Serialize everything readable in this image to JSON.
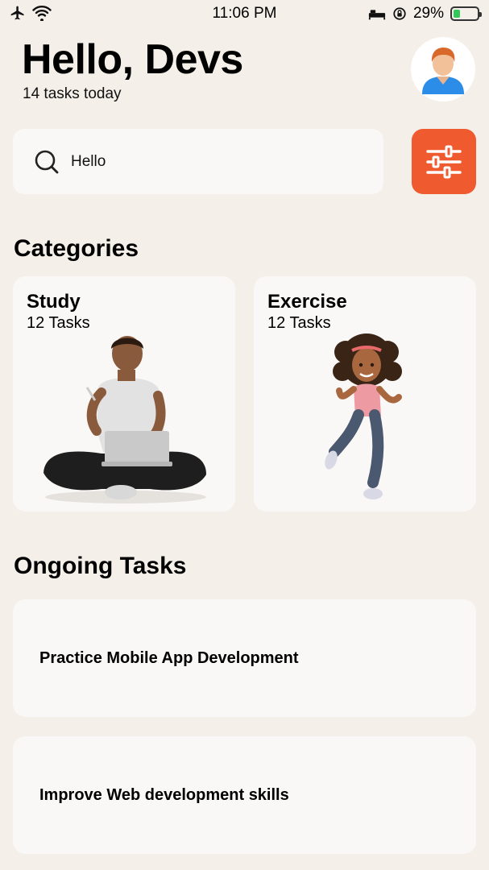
{
  "status_bar": {
    "time": "11:06 PM",
    "battery": "29%",
    "battery_level": 0.29,
    "icons": [
      "airplane-icon",
      "wifi-icon",
      "bed-icon",
      "orientation-lock-icon",
      "battery-charging-icon"
    ]
  },
  "header": {
    "greeting": "Hello, Devs",
    "subtitle": "14 tasks today",
    "avatar_icon": "user-avatar-icon"
  },
  "search": {
    "value": "Hello",
    "icon": "search-icon",
    "filter_icon": "sliders-icon"
  },
  "colors": {
    "background": "#f5efe9",
    "card": "#faf8f6",
    "accent": "#ef5a2f"
  },
  "categories": {
    "title": "Categories",
    "items": [
      {
        "title": "Study",
        "count": "12 Tasks",
        "illustration": "person-with-laptop"
      },
      {
        "title": "Exercise",
        "count": "12 Tasks",
        "illustration": "running-girl"
      }
    ]
  },
  "ongoing": {
    "title": "Ongoing Tasks",
    "items": [
      {
        "title": "Practice Mobile App Development"
      },
      {
        "title": "Improve Web development skills"
      }
    ]
  }
}
